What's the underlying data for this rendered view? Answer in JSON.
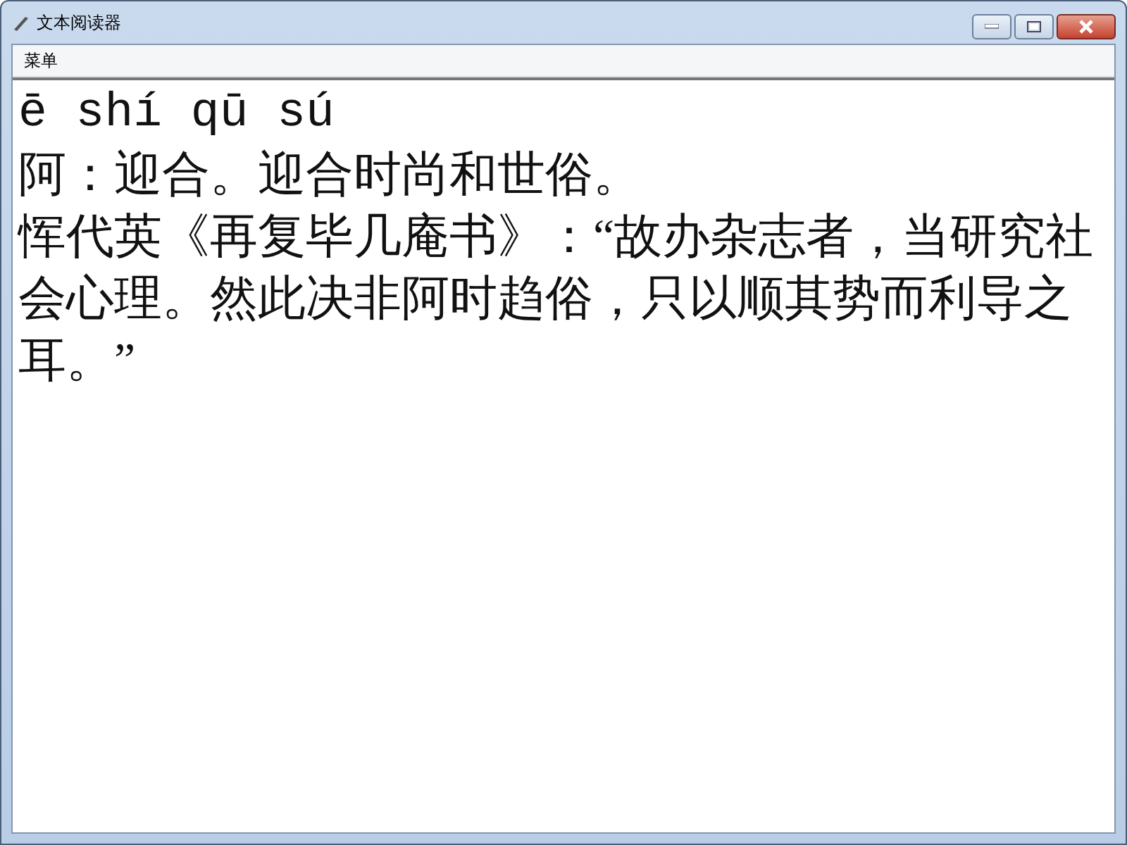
{
  "window": {
    "title": "文本阅读器"
  },
  "menu": [
    "菜单"
  ],
  "content": {
    "pinyin": "ē shí qū sú",
    "definition": "阿：迎合。迎合时尚和世俗。",
    "quote": "恽代英《再复毕几庵书》：“故办杂志者，当研究社会心理。然此决非阿时趋俗，只以顺其势而利导之耳。”"
  }
}
